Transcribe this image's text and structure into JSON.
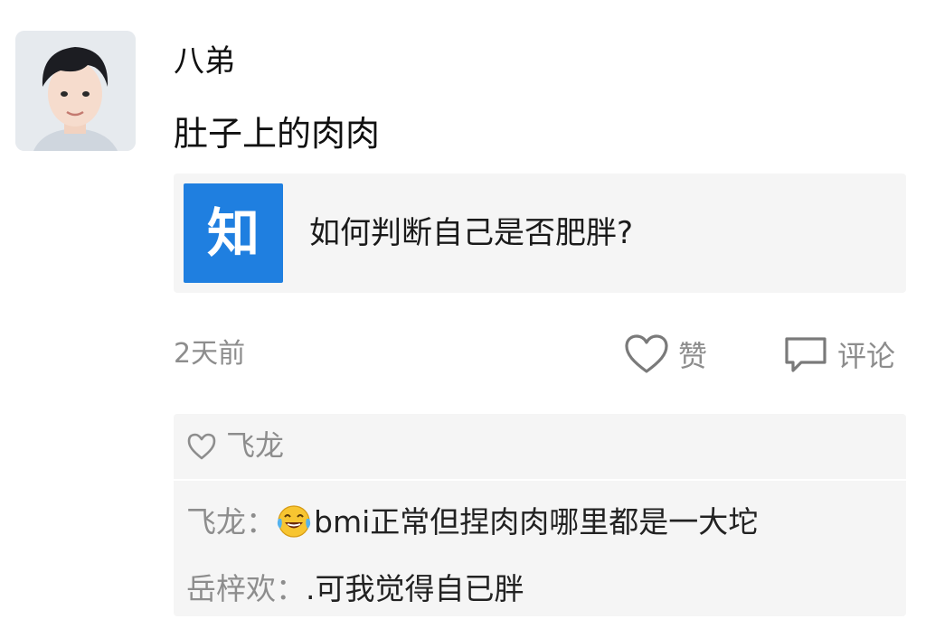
{
  "post": {
    "username": "八弟",
    "text": "肚子上的肉肉",
    "link_card": {
      "logo_text": "知",
      "title": "如何判断自己是否肥胖?"
    },
    "time": "2天前",
    "like_label": "赞",
    "comment_label": "评论"
  },
  "likes": {
    "users": "飞龙"
  },
  "comments": [
    {
      "author": "飞龙：",
      "emoji": "laughing-tears-emoji",
      "text": "bmi正常但捏肉肉哪里都是一大坨"
    },
    {
      "author": "岳梓欢：",
      "text": ".可我觉得自已胖"
    }
  ],
  "colors": {
    "zhihu_blue": "#1f7fe0",
    "card_bg": "#f5f5f5",
    "muted_text": "#8d8d8d"
  },
  "icons": [
    "heart-outline-icon",
    "comment-bubble-icon",
    "small-heart-icon"
  ]
}
